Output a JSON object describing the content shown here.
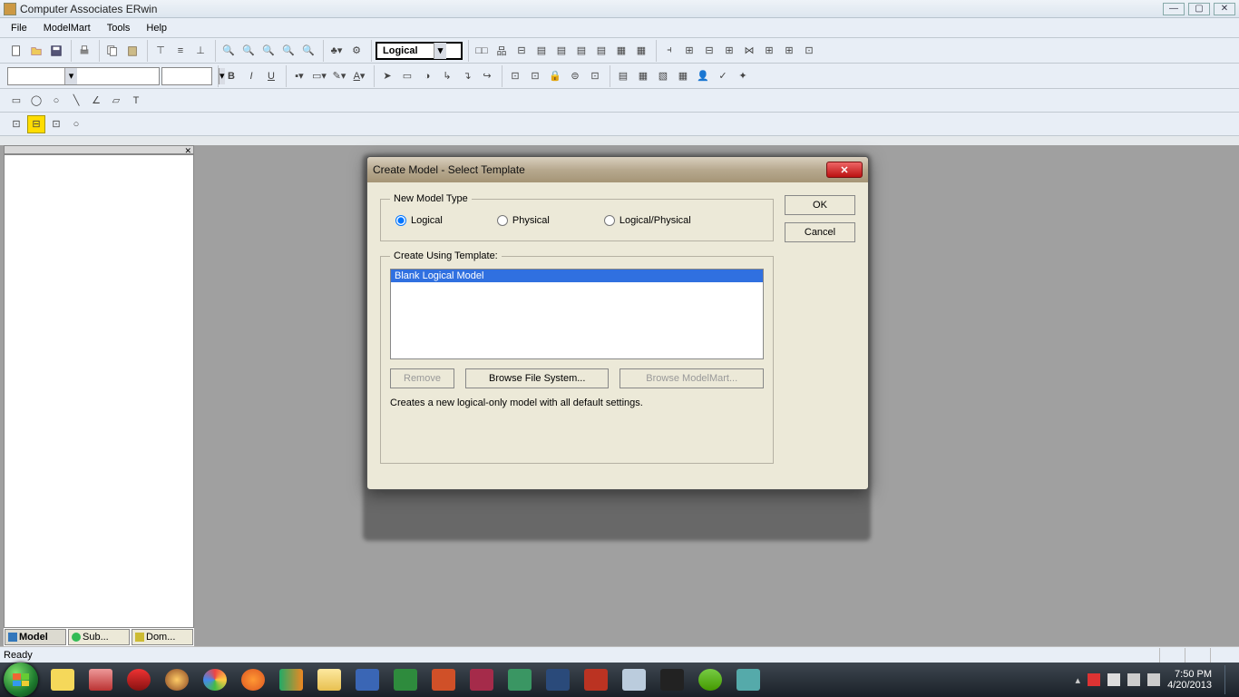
{
  "titlebar": {
    "app_title": "Computer Associates ERwin"
  },
  "menubar": {
    "items": [
      "File",
      "ModelMart",
      "Tools",
      "Help"
    ]
  },
  "toolbars": {
    "view_selector": "Logical"
  },
  "tree": {
    "tabs": [
      {
        "label": "Model",
        "active": true
      },
      {
        "label": "Sub..."
      },
      {
        "label": "Dom..."
      }
    ]
  },
  "statusbar": {
    "text": "Ready"
  },
  "dialog": {
    "title": "Create Model - Select Template",
    "group_model_type": "New Model Type",
    "radios": {
      "logical": "Logical",
      "physical": "Physical",
      "logical_physical": "Logical/Physical"
    },
    "group_template": "Create Using Template:",
    "template_item": "Blank Logical Model",
    "btn_remove": "Remove",
    "btn_browse_fs": "Browse File System...",
    "btn_browse_mm": "Browse ModelMart...",
    "description": "Creates a new logical-only model with all default settings.",
    "btn_ok": "OK",
    "btn_cancel": "Cancel"
  },
  "taskbar": {
    "time": "7:50 PM",
    "date": "4/20/2013"
  }
}
